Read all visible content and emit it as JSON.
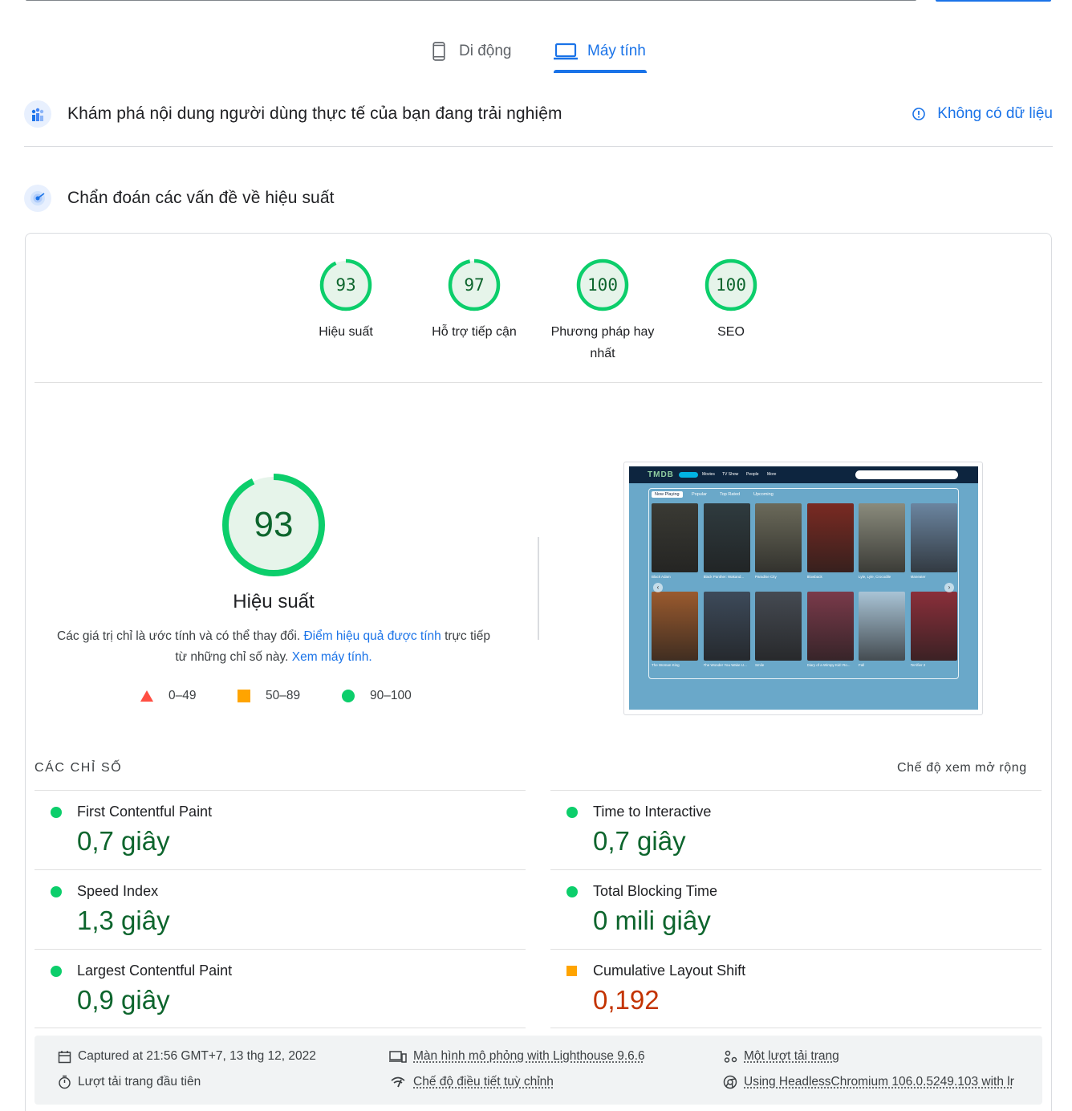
{
  "tabs": {
    "mobile": "Di động",
    "desktop": "Máy tính"
  },
  "crux": {
    "title": "Khám phá nội dung người dùng thực tế của bạn đang trải nghiệm",
    "no_data": "Không có dữ liệu"
  },
  "diagnose": {
    "title": "Chẩn đoán các vấn đề về hiệu suất"
  },
  "categories": [
    {
      "score": "93",
      "label": "Hiệu suất",
      "value": 93
    },
    {
      "score": "97",
      "label": "Hỗ trợ tiếp cận",
      "value": 97
    },
    {
      "score": "100",
      "label": "Phương pháp hay nhất",
      "value": 100
    },
    {
      "score": "100",
      "label": "SEO",
      "value": 100
    }
  ],
  "performance": {
    "score": "93",
    "value": 93,
    "title": "Hiệu suất",
    "desc_1": "Các giá trị chỉ là ước tính và có thể thay đổi. ",
    "desc_link_1": "Điểm hiệu quả được tính",
    "desc_2": " trực tiếp từ những chỉ số này. ",
    "desc_link_2": "Xem máy tính.",
    "legend": {
      "fail": "0–49",
      "average": "50–89",
      "pass": "90–100"
    }
  },
  "screenshot": {
    "logo": "TMDB",
    "nav": [
      "Movies",
      "TV Show",
      "People",
      "More"
    ],
    "tabs": [
      "Now Playing",
      "Popular",
      "Top Rated",
      "Upcoming"
    ],
    "row1": [
      "Black Adam",
      "Black Panther: Wakand...",
      "Paradise City",
      "Blowback",
      "Lyle, Lyle, Crocodile",
      "Maneater"
    ],
    "row2": [
      "The Woman King",
      "The Wonder You Wake U...",
      "Smile",
      "Diary of a Wimpy Kid: Ro...",
      "Fall",
      "Terrifier 2"
    ],
    "colors": [
      "#3a3a34",
      "#2f3b3f",
      "#6b6a5a",
      "#7a2a22",
      "#8a8b7c",
      "#6b85a0",
      "#9a5a2e",
      "#3d4a5a",
      "#454a52",
      "#7a3a4a",
      "#a9c4d6",
      "#8a2f3a"
    ]
  },
  "metrics": {
    "title": "CÁC CHỈ SỐ",
    "expand": "Chế độ xem mở rộng",
    "left": [
      {
        "name": "First Contentful Paint",
        "value": "0,7 giây",
        "status": "good"
      },
      {
        "name": "Speed Index",
        "value": "1,3 giây",
        "status": "good"
      },
      {
        "name": "Largest Contentful Paint",
        "value": "0,9 giây",
        "status": "good"
      }
    ],
    "right": [
      {
        "name": "Time to Interactive",
        "value": "0,7 giây",
        "status": "good"
      },
      {
        "name": "Total Blocking Time",
        "value": "0 mili giây",
        "status": "good"
      },
      {
        "name": "Cumulative Layout Shift",
        "value": "0,192",
        "status": "average"
      }
    ]
  },
  "runtime": {
    "captured": "Captured at 21:56 GMT+7, 13 thg 12, 2022",
    "first_load": "Lượt tải trang đầu tiên",
    "emulation": "Màn hình mô phỏng with Lighthouse 9.6.6",
    "throttling": "Chế độ điều tiết tuỳ chỉnh",
    "single_load": "Một lượt tải trang",
    "browser": "Using HeadlessChromium 106.0.5249.103 with lr"
  },
  "colors": {
    "accent": "#1a73e8",
    "pass": "#0cce6b",
    "pass_text": "#0d652d",
    "average": "#ffa400",
    "fail": "#ff4e42",
    "average_text": "#c33300"
  }
}
